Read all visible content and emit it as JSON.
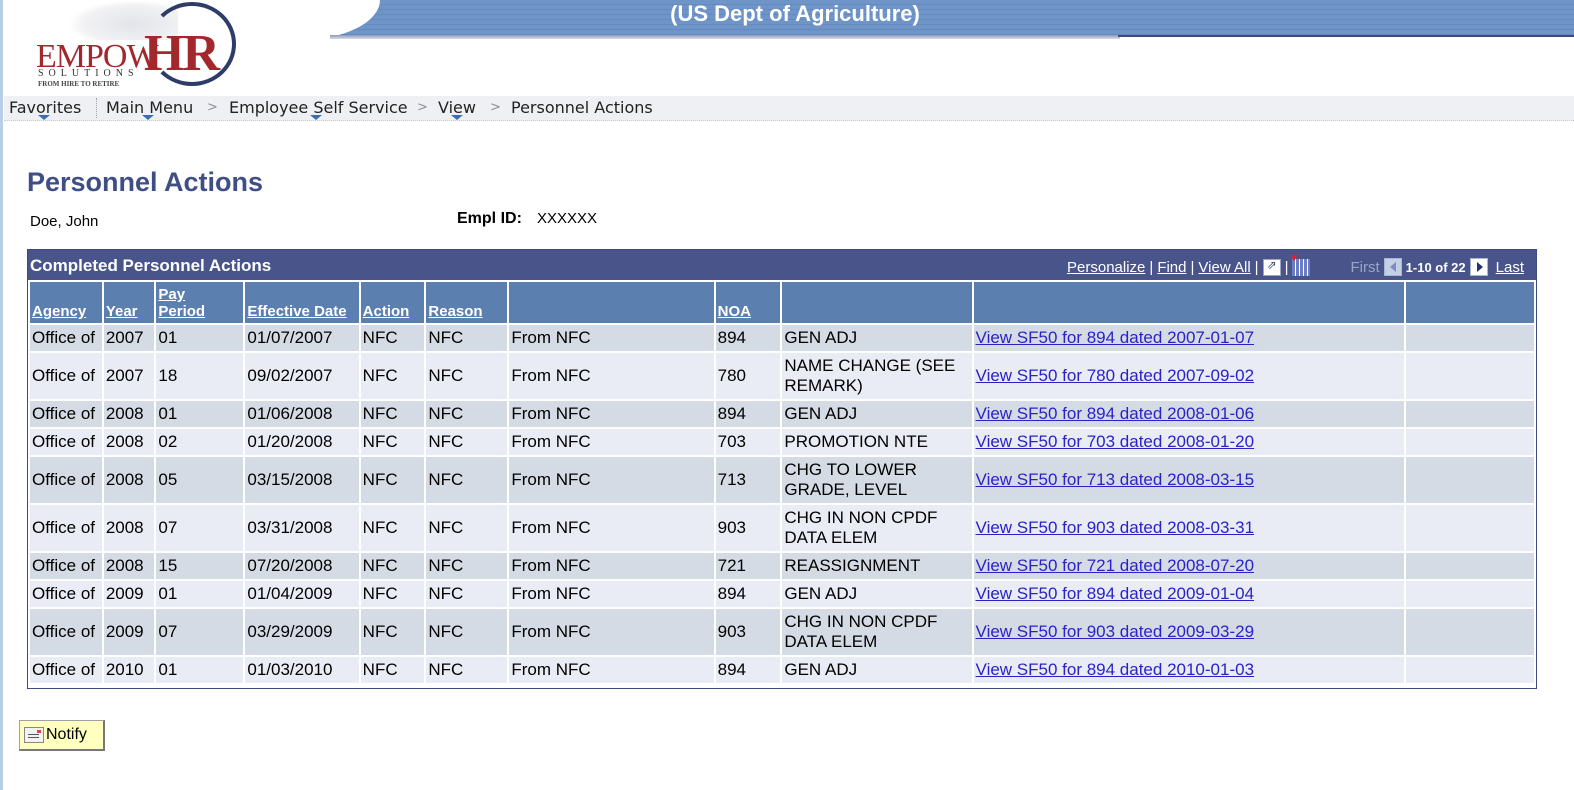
{
  "header": {
    "org": "(US Dept of Agriculture)",
    "logo": {
      "brand_left": "EMPOW",
      "brand_right": "HR",
      "solutions": "SOLUTIONS",
      "tagline": "FROM HIRE TO RETIRE"
    }
  },
  "nav": {
    "favorites": "Favorites",
    "breadcrumb": [
      "Main Menu",
      "Employee Self Service",
      "View",
      "Personnel Actions"
    ],
    "separator": ">"
  },
  "page": {
    "title": "Personnel Actions",
    "employee_name": "Doe, John",
    "empl_id_label": "Empl ID:",
    "empl_id_value": "XXXXXX"
  },
  "grid": {
    "title": "Completed Personnel Actions",
    "tools": {
      "personalize": "Personalize",
      "find": "Find",
      "view_all": "View All",
      "sep": "|",
      "first": "First",
      "range": "1-10 of 22",
      "last": "Last"
    },
    "columns": [
      "Agency",
      "Year",
      "Pay Period",
      "Effective Date",
      "Action",
      "Reason",
      "",
      "NOA",
      "",
      "",
      ""
    ],
    "rows": [
      {
        "agency": "Office of",
        "year": "2007",
        "pp": "01",
        "date": "01/07/2007",
        "action": "NFC",
        "reason": "NFC",
        "source": "From NFC",
        "noa": "894",
        "desc": "GEN ADJ",
        "link": "View SF50 for 894 dated 2007-01-07"
      },
      {
        "agency": "Office of",
        "year": "2007",
        "pp": "18",
        "date": "09/02/2007",
        "action": "NFC",
        "reason": "NFC",
        "source": "From NFC",
        "noa": "780",
        "desc": "NAME CHANGE (SEE REMARK)",
        "link": "View SF50 for 780 dated 2007-09-02"
      },
      {
        "agency": "Office of",
        "year": "2008",
        "pp": "01",
        "date": "01/06/2008",
        "action": "NFC",
        "reason": "NFC",
        "source": "From NFC",
        "noa": "894",
        "desc": "GEN ADJ",
        "link": "View SF50 for 894 dated 2008-01-06"
      },
      {
        "agency": "Office of",
        "year": "2008",
        "pp": "02",
        "date": "01/20/2008",
        "action": "NFC",
        "reason": "NFC",
        "source": "From NFC",
        "noa": "703",
        "desc": "PROMOTION NTE",
        "link": "View SF50 for 703 dated 2008-01-20"
      },
      {
        "agency": "Office of",
        "year": "2008",
        "pp": "05",
        "date": "03/15/2008",
        "action": "NFC",
        "reason": "NFC",
        "source": "From NFC",
        "noa": "713",
        "desc": "CHG TO LOWER GRADE, LEVEL",
        "link": "View SF50 for 713 dated 2008-03-15"
      },
      {
        "agency": "Office of",
        "year": "2008",
        "pp": "07",
        "date": "03/31/2008",
        "action": "NFC",
        "reason": "NFC",
        "source": "From NFC",
        "noa": "903",
        "desc": "CHG IN NON CPDF DATA ELEM",
        "link": "View SF50 for 903 dated 2008-03-31"
      },
      {
        "agency": "Office of",
        "year": "2008",
        "pp": "15",
        "date": "07/20/2008",
        "action": "NFC",
        "reason": "NFC",
        "source": "From NFC",
        "noa": "721",
        "desc": "REASSIGNMENT",
        "link": "View SF50 for 721 dated 2008-07-20"
      },
      {
        "agency": "Office of",
        "year": "2009",
        "pp": "01",
        "date": "01/04/2009",
        "action": "NFC",
        "reason": "NFC",
        "source": "From NFC",
        "noa": "894",
        "desc": "GEN ADJ",
        "link": "View SF50 for 894 dated 2009-01-04"
      },
      {
        "agency": "Office of",
        "year": "2009",
        "pp": "07",
        "date": "03/29/2009",
        "action": "NFC",
        "reason": "NFC",
        "source": "From NFC",
        "noa": "903",
        "desc": "CHG IN NON CPDF DATA ELEM",
        "link": "View SF50 for 903 dated 2009-03-29"
      },
      {
        "agency": "Office of",
        "year": "2010",
        "pp": "01",
        "date": "01/03/2010",
        "action": "NFC",
        "reason": "NFC",
        "source": "From NFC",
        "noa": "894",
        "desc": "GEN ADJ",
        "link": "View SF50 for 894 dated 2010-01-03"
      }
    ]
  },
  "footer": {
    "notify_label": "Notify"
  }
}
